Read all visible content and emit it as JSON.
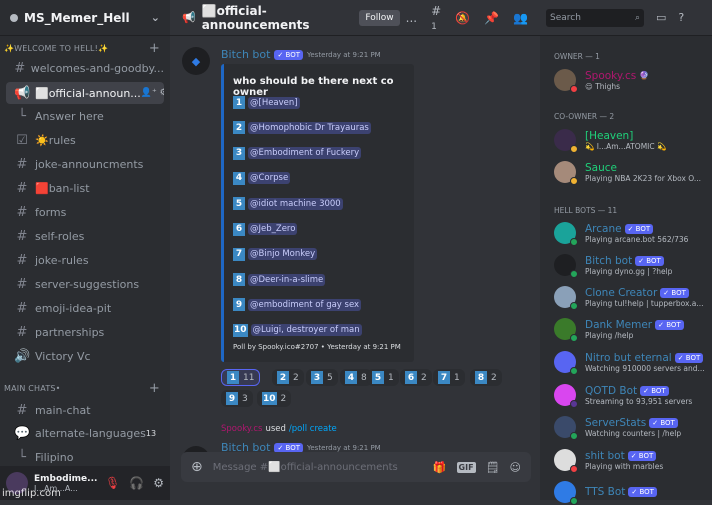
{
  "server": {
    "name": "MS_Memer_Hell",
    "chevron_icon": "chevron-down-icon"
  },
  "categories": [
    {
      "label": "✨WELCOME TO HELL!✨"
    },
    {
      "label": "MAIN CHATS•"
    }
  ],
  "channels": [
    {
      "label": "welcomes-and-goodby...",
      "icon": "#",
      "cat": 0
    },
    {
      "label": "⬜official-announ...",
      "icon": "📢",
      "selected": true,
      "tools": "👤⁺ ⚙"
    },
    {
      "label": "Answer here",
      "icon": "└",
      "thread": true
    },
    {
      "label": "☀️rules",
      "icon": "☑"
    },
    {
      "label": "joke-announcments",
      "icon": "#"
    },
    {
      "label": "🟥ban-list",
      "icon": "#"
    },
    {
      "label": "forms",
      "icon": "#"
    },
    {
      "label": "self-roles",
      "icon": "#"
    },
    {
      "label": "joke-rules",
      "icon": "#"
    },
    {
      "label": "server-suggestions",
      "icon": "#"
    },
    {
      "label": "emoji-idea-pit",
      "icon": "#"
    },
    {
      "label": "partnerships",
      "icon": "#"
    },
    {
      "label": "Victory Vc",
      "icon": "🔊"
    },
    {
      "label": "main-chat",
      "icon": "#"
    },
    {
      "label": "alternate-languages",
      "icon": "💬",
      "badge": "13"
    },
    {
      "label": "Filipino",
      "icon": "└",
      "thread": true
    }
  ],
  "user": {
    "name": "Embodime...",
    "status": "I...Am...A...",
    "watermark": "imgflip.com"
  },
  "header": {
    "channel": "⬜official-announcements",
    "follow": "Follow",
    "more": "...",
    "threads_count": "1"
  },
  "message": {
    "author": "Bitch bot",
    "bot_badge": "✓ BOT",
    "timestamp": "Yesterday at 9:21 PM",
    "question": "who should be there next co owner",
    "options": [
      {
        "n": "1",
        "name": "@[Heaven]",
        "votes": "11"
      },
      {
        "n": "2",
        "name": "@Homophobic Dr Trayauras",
        "votes": "2"
      },
      {
        "n": "3",
        "name": "@Embodiment of Fuckery",
        "votes": "5"
      },
      {
        "n": "4",
        "name": "@Corpse",
        "votes": "8"
      },
      {
        "n": "5",
        "name": "@idiot machine 3000",
        "votes": "1"
      },
      {
        "n": "6",
        "name": "@Jeb_Zero",
        "votes": "2"
      },
      {
        "n": "7",
        "name": "@Binjo Monkey",
        "votes": "1"
      },
      {
        "n": "8",
        "name": "@Deer-in-a-slime",
        "votes": "2"
      },
      {
        "n": "9",
        "name": "@embodiment of gay sex",
        "votes": "3"
      },
      {
        "n": "10",
        "name": "@Luigi, destroyer of man",
        "votes": "2"
      }
    ],
    "footer": "Poll by Spooky.ico#2707 • Yesterday at 9:21 PM"
  },
  "system": {
    "user": "Spooky.cs",
    "used": "used",
    "command": "/poll create"
  },
  "message2": {
    "author": "Bitch bot",
    "bot_badge": "✓ BOT",
    "timestamp": "Yesterday at 9:21 PM"
  },
  "composer": {
    "placeholder": "Message #⬜official-announcements"
  },
  "search": {
    "placeholder": "Search"
  },
  "member_groups": [
    {
      "label": "OWNER — 1"
    },
    {
      "label": "CO-OWNER — 2"
    },
    {
      "label": "HELL BOTS — 11"
    }
  ],
  "members": [
    {
      "name": "Spooky.cs",
      "status": "😌 Thighs",
      "color": "#b0176f",
      "dot": "#f23f43",
      "suffix": "🔮"
    },
    {
      "name": "[Heaven]",
      "status": "💫 I...Am...ATOMIC 💫",
      "color": "#1fd17a",
      "dot": "#f0b232"
    },
    {
      "name": "Sauce",
      "status": "Playing NBA 2K23 for Xbox O...",
      "color": "#1fd17a",
      "dot": "#f0b232"
    },
    {
      "name": "Arcane",
      "status": "Playing arcane.bot 562/736",
      "color": "#3e86b8",
      "dot": "#23a55a",
      "bot": true
    },
    {
      "name": "Bitch bot",
      "status": "Playing dyno.gg | ?help",
      "color": "#3e86b8",
      "dot": "#23a55a",
      "bot": true
    },
    {
      "name": "Clone Creator",
      "status": "Playing tul!help | tupperbox.a...",
      "color": "#3e86b8",
      "dot": "#23a55a",
      "bot": true
    },
    {
      "name": "Dank Memer",
      "status": "Playing /help",
      "color": "#3e86b8",
      "dot": "#23a55a",
      "bot": true
    },
    {
      "name": "Nitro but eternal",
      "status": "Watching 910000 servers and...",
      "color": "#3e86b8",
      "dot": "#23a55a",
      "bot": true
    },
    {
      "name": "QOTD Bot",
      "status": "Streaming to 93,951 servers",
      "color": "#3e86b8",
      "dot": "#593695",
      "bot": true
    },
    {
      "name": "ServerStats",
      "status": "Watching counters | /help",
      "color": "#3e86b8",
      "dot": "#23a55a",
      "bot": true
    },
    {
      "name": "shit bot",
      "status": "Playing with marbles",
      "color": "#3e86b8",
      "dot": "#f23f43",
      "bot": true
    },
    {
      "name": "TTS Bot",
      "status": "",
      "color": "#3e86b8",
      "dot": "#23a55a",
      "bot": true
    }
  ],
  "bot_badge": "✓ BOT"
}
